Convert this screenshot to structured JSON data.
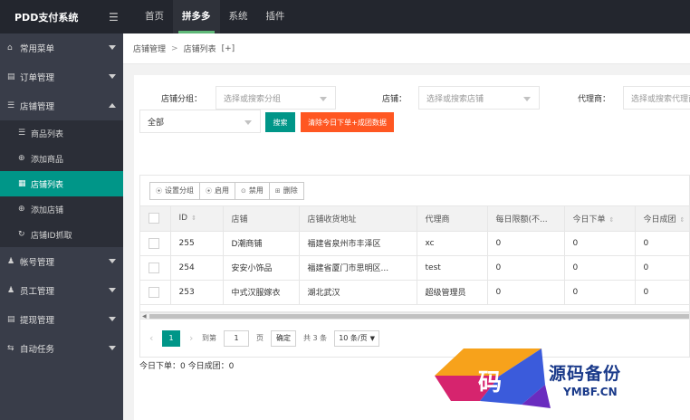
{
  "header": {
    "logo": "PDD支付系统",
    "menu_icon": "☰",
    "nav": [
      "首页",
      "拼多多",
      "系统",
      "插件"
    ],
    "active_nav": "拼多多"
  },
  "sidebar": {
    "groups": [
      {
        "icon": "home-icon",
        "glyph": "⌂",
        "label": "常用菜单"
      },
      {
        "icon": "order-icon",
        "glyph": "▤",
        "label": "订单管理"
      },
      {
        "icon": "store-icon",
        "glyph": "☰",
        "label": "店铺管理"
      },
      {
        "icon": "account-icon",
        "glyph": "♟",
        "label": "帐号管理"
      },
      {
        "icon": "staff-icon",
        "glyph": "♟",
        "label": "员工管理"
      },
      {
        "icon": "withdraw-icon",
        "glyph": "▤",
        "label": "提现管理"
      },
      {
        "icon": "auto-task-icon",
        "glyph": "⇆",
        "label": "自动任务"
      }
    ],
    "store_sub": [
      {
        "icon": "list-icon",
        "glyph": "☰",
        "label": "商品列表"
      },
      {
        "icon": "plus-circle-icon",
        "glyph": "⊕",
        "label": "添加商品"
      },
      {
        "icon": "grid-icon",
        "glyph": "▦",
        "label": "店铺列表"
      },
      {
        "icon": "plus-circle-icon",
        "glyph": "⊕",
        "label": "添加店铺"
      },
      {
        "icon": "refresh-icon",
        "glyph": "↻",
        "label": "店铺ID抓取"
      }
    ]
  },
  "breadcrumb": {
    "items": [
      "店铺管理",
      "店铺列表"
    ],
    "sep": ">",
    "extra": "[+]"
  },
  "filters": {
    "group_label": "店铺分组：",
    "group_placeholder": "选择或搜索分组",
    "store_label": "店铺：",
    "store_placeholder": "选择或搜索店铺",
    "agent_label": "代理商：",
    "agent_placeholder": "选择或搜索代理商",
    "status_value": "全部",
    "search_btn": "搜索",
    "clear_btn": "清除今日下单+成团数据"
  },
  "toolbar": {
    "set_group": "设置分组",
    "enable": "启用",
    "disable": "禁用",
    "delete": "删除"
  },
  "table": {
    "columns": [
      "ID",
      "店铺",
      "店铺收货地址",
      "代理商",
      "每日限额(不...",
      "今日下单",
      "今日成团"
    ],
    "rows": [
      [
        "255",
        "D潮商铺",
        "福建省泉州市丰泽区",
        "xc",
        "0",
        "0",
        "0"
      ],
      [
        "254",
        "安安小饰品",
        "福建省厦门市思明区...",
        "test",
        "0",
        "0",
        "0"
      ],
      [
        "253",
        "中式汉服嫁衣",
        "湖北武汉",
        "超级管理员",
        "0",
        "0",
        "0"
      ]
    ]
  },
  "pager": {
    "current": "1",
    "goto_label": "到第",
    "goto_value": "1",
    "page_unit": "页",
    "confirm": "确定",
    "total": "共 3 条",
    "page_size": "10 条/页"
  },
  "summary": "今日下单：0 今日成团：0",
  "watermark": {
    "glyph": "码",
    "title": "源码备份",
    "url": "YMBF.CN"
  }
}
